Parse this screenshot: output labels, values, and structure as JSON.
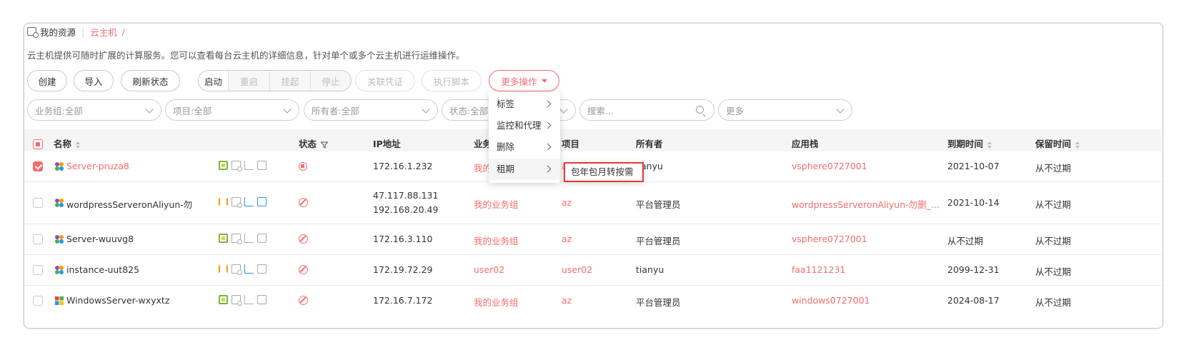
{
  "breadcrumb": {
    "root": "我的资源",
    "current": "云主机",
    "slash": "/"
  },
  "description": "云主机提供可随时扩展的计算服务。您可以查看每台云主机的详细信息，针对单个或多个云主机进行运维操作。",
  "toolbar": {
    "create": "创建",
    "import": "导入",
    "refresh": "刷新状态",
    "start": "启动",
    "restart": "重启",
    "suspend": "挂起",
    "stop": "停止",
    "bind_cert": "关联凭证",
    "exec_script": "执行脚本",
    "more_ops": "更多操作"
  },
  "filters": {
    "biz_group": "业务组:全部",
    "project": "项目:全部",
    "owner": "所有者:全部",
    "status": "状态:全部",
    "search_placeholder": "搜索...",
    "more": "更多"
  },
  "table": {
    "headers": {
      "name": "名称",
      "status": "状态",
      "ip": "IP地址",
      "biz": "业务组",
      "project": "项目",
      "owner": "所有者",
      "stack": "应用栈",
      "expire": "到期时间",
      "retain": "保留时间"
    },
    "rows": [
      {
        "name": "Server-pruza8",
        "ip1": "172.16.1.232",
        "ip2": "",
        "biz": "我的业务组",
        "project": "az",
        "owner": "tianyu",
        "owner_visible": "anyu",
        "stack": "vsphere0727001",
        "expire": "2021-10-07",
        "retain": "从不过期"
      },
      {
        "name": "wordpressServeronAliyun-勿",
        "ip1": "47.117.88.131",
        "ip2": "192.168.20.49",
        "biz": "我的业务组",
        "project": "az",
        "owner": "平台管理员",
        "stack": "wordpressServeronAliyun-勿删_...",
        "expire": "2021-10-14",
        "retain": "从不过期"
      },
      {
        "name": "Server-wuuvg8",
        "ip1": "172.16.3.110",
        "ip2": "",
        "biz": "我的业务组",
        "project": "az",
        "owner": "平台管理员",
        "stack": "vsphere0727001",
        "expire": "从不过期",
        "retain": "从不过期"
      },
      {
        "name": "instance-uut825",
        "ip1": "172.19.72.29",
        "ip2": "",
        "biz": "user02",
        "project": "user02",
        "owner": "tianyu",
        "stack": "faa1121231",
        "expire": "2099-12-31",
        "retain": "从不过期"
      },
      {
        "name": "WindowsServer-wxyxtz",
        "ip1": "172.16.7.172",
        "ip2": "",
        "biz": "我的业务组",
        "project": "az",
        "owner": "平台管理员",
        "stack": "windows0727001",
        "expire": "2024-08-17",
        "retain": "从不过期"
      }
    ]
  },
  "more_menu": {
    "tag": "标签",
    "monitor": "监控和代理",
    "delete": "删除",
    "lease": "租期"
  },
  "lease_submenu": {
    "convert": "包年包月转按需"
  },
  "colors": {
    "accent": "#f56c6c",
    "highlight_border": "#e53935"
  }
}
